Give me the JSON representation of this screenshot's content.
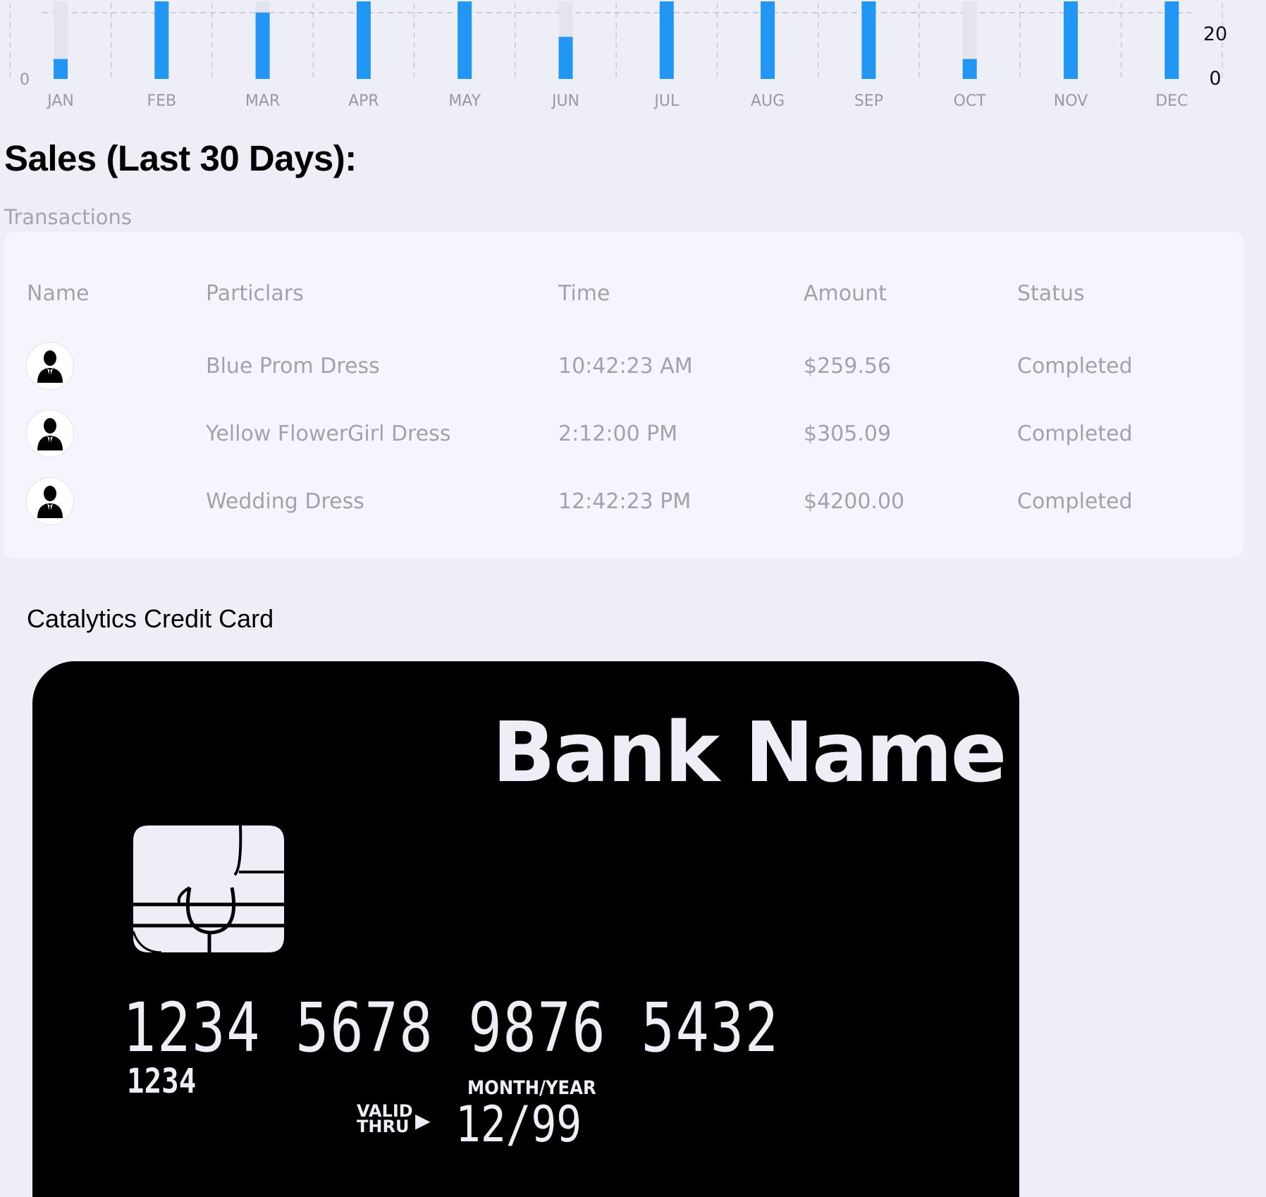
{
  "chart_data": {
    "type": "bar",
    "categories": [
      "JAN",
      "FEB",
      "MAR",
      "APR",
      "MAY",
      "JUN",
      "JUL",
      "AUG",
      "SEP",
      "OCT",
      "NOV",
      "DEC"
    ],
    "values": [
      9,
      35,
      30,
      35,
      35,
      19,
      35,
      35,
      35,
      9,
      35,
      35
    ],
    "left_axis_ticks": [
      "0"
    ],
    "right_axis_ticks": [
      "20",
      "0"
    ],
    "ylim": [
      0,
      35
    ],
    "grid": true,
    "colors": {
      "bar": "#2196f3",
      "track": "#e4e5ec",
      "grid": "#c2c2c6",
      "axis_text": "#9a9a9e",
      "right_axis_text": "#111111"
    }
  },
  "sales": {
    "title": "Sales (Last 30 Days):",
    "transactions_label": "Transactions",
    "columns": [
      "Name",
      "Particlars",
      "Time",
      "Amount",
      "Status"
    ],
    "rows": [
      {
        "avatar": "user-avatar-icon",
        "particulars": "Blue Prom Dress",
        "time": "10:42:23 AM",
        "amount": "$259.56",
        "status": "Completed"
      },
      {
        "avatar": "user-avatar-icon",
        "particulars": "Yellow FlowerGirl Dress",
        "time": "2:12:00 PM",
        "amount": "$305.09",
        "status": "Completed"
      },
      {
        "avatar": "user-avatar-icon",
        "particulars": "Wedding Dress",
        "time": "12:42:23 PM",
        "amount": "$4200.00",
        "status": "Completed"
      }
    ]
  },
  "credit_card": {
    "heading": "Catalytics Credit Card",
    "bank_name": "Bank Name",
    "number": "1234 5678 9876 5432",
    "small_number": "1234",
    "expiry_label": "MONTH/YEAR",
    "valid_thru": "VALID\nTHRU",
    "expiry": "12/99",
    "chip_icon": "card-chip-icon",
    "colors": {
      "card": "#000000",
      "text": "#edeef6"
    }
  }
}
